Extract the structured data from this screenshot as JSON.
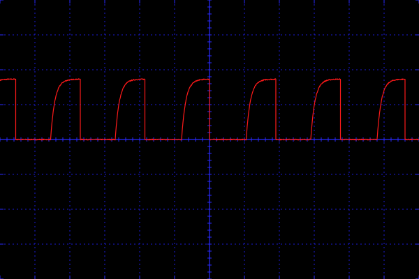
{
  "chart_data": {
    "type": "line",
    "title": "",
    "xlabel": "",
    "ylabel": "",
    "grid": true,
    "divisions": {
      "x": 12,
      "y": 8
    },
    "xlim": [
      0,
      12
    ],
    "ylim": [
      -4,
      4
    ],
    "colors": {
      "background": "#000000",
      "grid": "#1b1bd8",
      "axis": "#2a2aff",
      "trace": "#ff1a1a"
    },
    "series": [
      {
        "name": "",
        "waveform": "square-rc",
        "low": 0.0,
        "high": 1.73,
        "tau": 0.12,
        "edges": [
          {
            "rise": -0.5,
            "fall": 0.45
          },
          {
            "rise": 1.45,
            "fall": 2.3
          },
          {
            "rise": 3.3,
            "fall": 4.15
          },
          {
            "rise": 5.2,
            "fall": 6.0
          },
          {
            "rise": 7.05,
            "fall": 7.9
          },
          {
            "rise": 8.9,
            "fall": 9.75
          },
          {
            "rise": 10.8,
            "fall": 11.6
          }
        ]
      }
    ]
  }
}
